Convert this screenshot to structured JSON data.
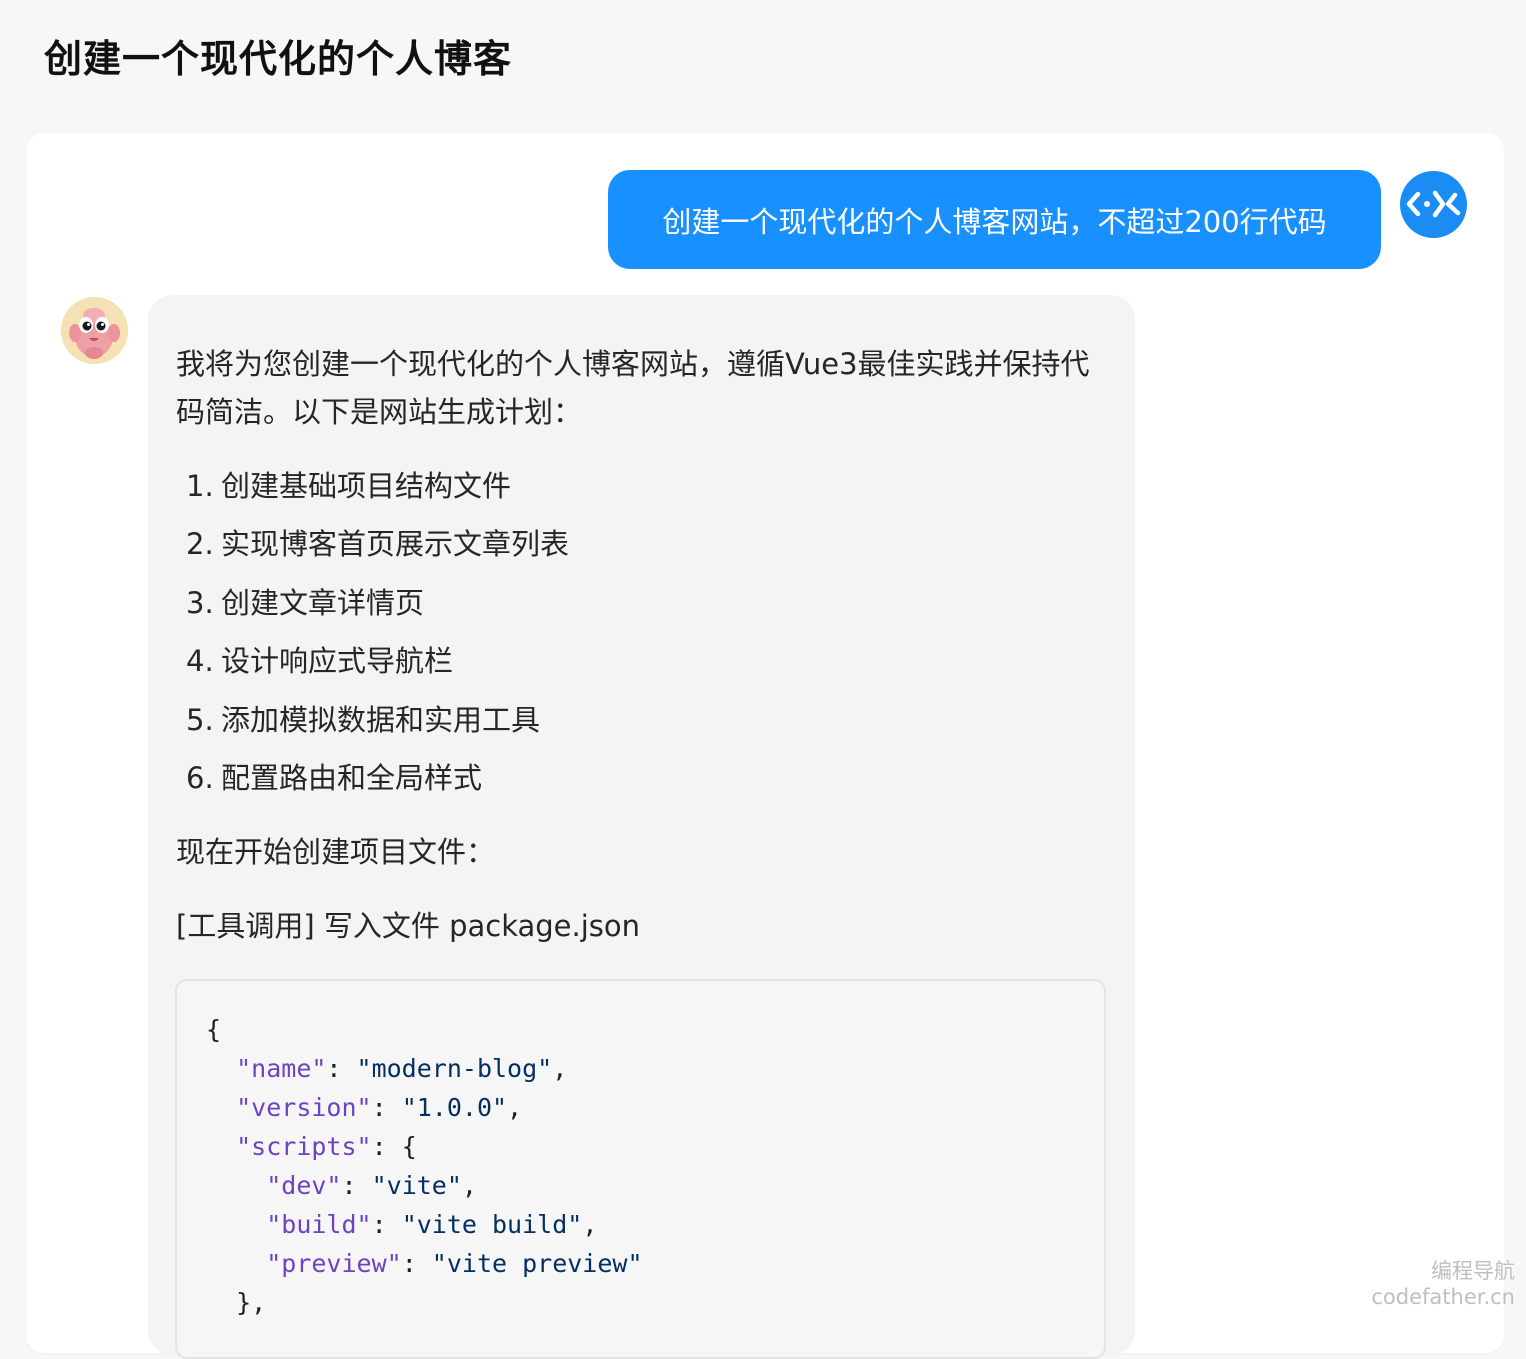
{
  "page": {
    "title": "创建一个现代化的个人博客"
  },
  "user_message": {
    "text": "创建一个现代化的个人博客网站，不超过200行代码"
  },
  "assistant_message": {
    "intro": "我将为您创建一个现代化的个人博客网站，遵循Vue3最佳实践并保持代码简洁。以下是网站生成计划：",
    "plan": [
      {
        "num": "1.",
        "text": "创建基础项目结构文件"
      },
      {
        "num": "2.",
        "text": "实现博客首页展示文章列表"
      },
      {
        "num": "3.",
        "text": "创建文章详情页"
      },
      {
        "num": "4.",
        "text": "设计响应式导航栏"
      },
      {
        "num": "5.",
        "text": "添加模拟数据和实用工具"
      },
      {
        "num": "6.",
        "text": "配置路由和全局样式"
      }
    ],
    "start_text": "现在开始创建项目文件：",
    "tool_call": "[工具调用] 写入文件 package.json",
    "code_lines": [
      {
        "indent": "",
        "key": "",
        "sep": "",
        "value": "",
        "tail": "{"
      },
      {
        "indent": "  ",
        "key": "\"name\"",
        "sep": ": ",
        "value": "\"modern-blog\"",
        "tail": ","
      },
      {
        "indent": "  ",
        "key": "\"version\"",
        "sep": ": ",
        "value": "\"1.0.0\"",
        "tail": ","
      },
      {
        "indent": "  ",
        "key": "\"scripts\"",
        "sep": ": ",
        "value": "",
        "tail": "{"
      },
      {
        "indent": "    ",
        "key": "\"dev\"",
        "sep": ": ",
        "value": "\"vite\"",
        "tail": ","
      },
      {
        "indent": "    ",
        "key": "\"build\"",
        "sep": ": ",
        "value": "\"vite build\"",
        "tail": ","
      },
      {
        "indent": "    ",
        "key": "\"preview\"",
        "sep": ": ",
        "value": "\"vite preview\"",
        "tail": ""
      },
      {
        "indent": "  ",
        "key": "",
        "sep": "",
        "value": "",
        "tail": "},"
      }
    ]
  },
  "watermark": {
    "line1": "编程导航",
    "line2": "codefather.cn"
  },
  "colors": {
    "user_bubble": "#1890ff",
    "user_avatar": "#1c8cf5",
    "ai_bubble": "#f4f4f5",
    "json_key": "#6f42c1",
    "json_string": "#032f62"
  },
  "icons": {
    "user_avatar": "code-brackets-icon",
    "ai_avatar": "cartoon-mascot-icon"
  }
}
